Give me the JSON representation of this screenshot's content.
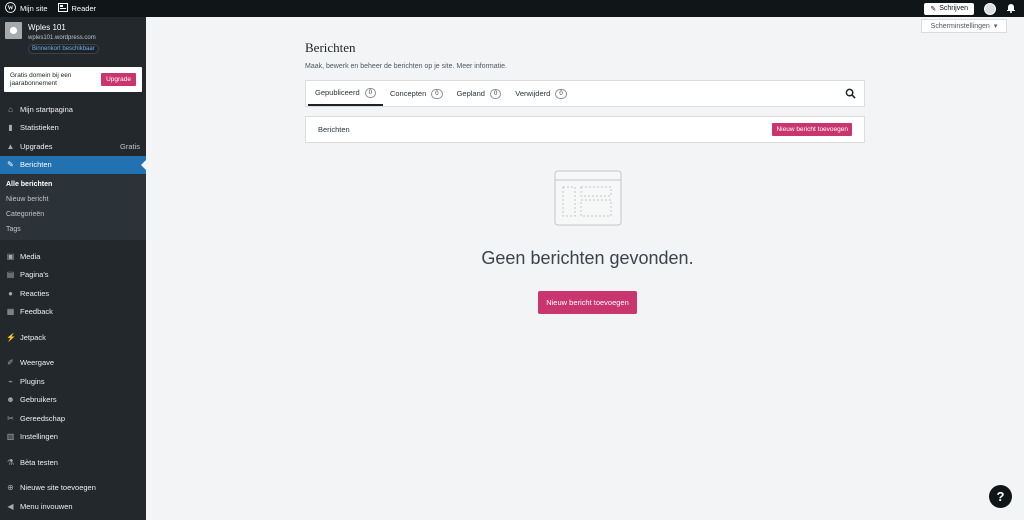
{
  "topbar": {
    "my_site": "Mijn site",
    "reader": "Reader",
    "write": "Schrijven"
  },
  "site": {
    "name": "Wples 101",
    "url": "wples101.wordpress.com",
    "badge": "Binnenkort beschikbaar"
  },
  "promo": {
    "text": "Gratis domein bij een jaarabonnement",
    "button": "Upgrade"
  },
  "sidebar": {
    "items": [
      {
        "label": "Mijn startpagina",
        "icon": "home-icon"
      },
      {
        "label": "Statistieken",
        "icon": "stats-icon"
      },
      {
        "label": "Upgrades",
        "icon": "upgrades-icon",
        "extra": "Gratis"
      },
      {
        "label": "Berichten",
        "icon": "pin-icon"
      }
    ],
    "sub": [
      "Alle berichten",
      "Nieuw bericht",
      "Categorieën",
      "Tags"
    ],
    "items2": [
      {
        "label": "Media",
        "icon": "media-icon"
      },
      {
        "label": "Pagina's",
        "icon": "page-icon"
      },
      {
        "label": "Reacties",
        "icon": "comment-icon"
      },
      {
        "label": "Feedback",
        "icon": "feedback-icon"
      }
    ],
    "jetpack": "Jetpack",
    "items3": [
      {
        "label": "Weergave",
        "icon": "brush-icon"
      },
      {
        "label": "Plugins",
        "icon": "plug-icon"
      },
      {
        "label": "Gebruikers",
        "icon": "users-icon"
      },
      {
        "label": "Gereedschap",
        "icon": "wrench-icon"
      },
      {
        "label": "Instellingen",
        "icon": "settings-icon"
      }
    ],
    "beta": "Bèta testen",
    "add_site": "Nieuwe site toevoegen",
    "collapse": "Menu invouwen"
  },
  "main": {
    "title": "Berichten",
    "subtitle": "Maak, bewerk en beheer de berichten op je site. Meer informatie.",
    "tabs": [
      {
        "label": "Gepubliceerd",
        "count": "0"
      },
      {
        "label": "Concepten",
        "count": "0"
      },
      {
        "label": "Gepland",
        "count": "0"
      },
      {
        "label": "Verwijderd",
        "count": "0"
      }
    ],
    "section_title": "Berichten",
    "add_button": "Nieuw bericht toevoegen",
    "empty_title": "Geen berichten gevonden.",
    "empty_button": "Nieuw bericht toevoegen"
  },
  "screen_options": "Scherminstellingen",
  "help": "?",
  "colors": {
    "accent": "#c9356e",
    "active": "#2271b1",
    "sidebar": "#23282d",
    "topbar": "#101517"
  }
}
